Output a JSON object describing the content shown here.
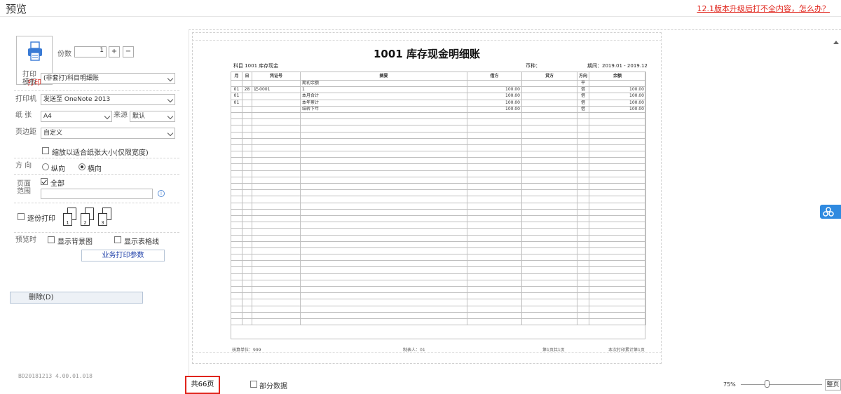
{
  "window": {
    "title": "预览",
    "help_link": "12.1版本升级后打不全内容，怎么办？"
  },
  "print_panel": {
    "print_button": "打印",
    "copies_label": "份数",
    "copies_value": "1",
    "plus": "+",
    "minus": "−",
    "template_label": "打印模板",
    "template_value": "(非套打)科目明细账",
    "printer_label": "打印机",
    "printer_value": "发送至 OneNote 2013",
    "paper_label": "纸  张",
    "paper_value": "A4",
    "source_label": "来源",
    "source_value": "默认",
    "margin_label": "页边距",
    "margin_value": "自定义",
    "fit_paper": "缩放以适合纸张大小(仅限宽度)",
    "orientation_label": "方  向",
    "portrait": "纵向",
    "landscape": "横向",
    "page_range_label": "页面范围",
    "all_pages": "全部",
    "collate_label": "逐份打印",
    "preview_label": "预览时",
    "show_background": "显示背景图",
    "show_gridlines": "显示表格线",
    "business_params": "业务打印参数",
    "delete_button": "删除(D)",
    "version": "BD20181213 4.00.01.018"
  },
  "document": {
    "title": "1001 库存现金明细账",
    "subject": "科目  1001 库存现金",
    "currency": "币种：",
    "period": "期间：2019.01 - 2019.12",
    "columns": [
      "月",
      "日",
      "凭证号",
      "摘要",
      "借方",
      "贷方",
      "方向",
      "余额"
    ],
    "rows": [
      [
        "",
        "",
        "",
        "期初余额",
        "",
        "",
        "平",
        ""
      ],
      [
        "01",
        "28",
        "记-0001",
        "1",
        "100.00",
        "",
        "借",
        "100.00"
      ],
      [
        "01",
        "",
        "",
        "本月合计",
        "100.00",
        "",
        "借",
        "100.00"
      ],
      [
        "01",
        "",
        "",
        "本年累计",
        "100.00",
        "",
        "借",
        "100.00"
      ],
      [
        "",
        "",
        "",
        "结转下年",
        "100.00",
        "",
        "借",
        "100.00"
      ]
    ],
    "footer_unit": "核算单位：999",
    "footer_maker": "制表人：01",
    "footer_page": "第1页共1页",
    "footer_total": "本次打印累计第1页"
  },
  "bottom_bar": {
    "page_count": "共66页",
    "partial_data": "部分数据",
    "zoom": "75%",
    "zoom_level": 0.33,
    "fit_page": "整页"
  }
}
